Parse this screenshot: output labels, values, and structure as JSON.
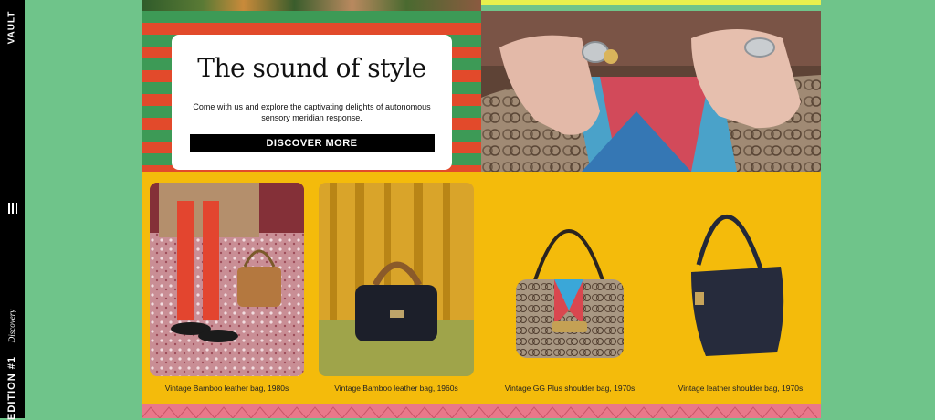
{
  "sidebar": {
    "brand": "VAULT",
    "discovery_label": "Discovery",
    "edition_label": "EDITION #1"
  },
  "promo": {
    "title": "The sound of style",
    "text": "Come with us and explore the captivating delights of autonomous sensory meridian response.",
    "button_label": "DISCOVER MORE"
  },
  "products": [
    {
      "caption": "Vintage Bamboo leather bag, 1980s"
    },
    {
      "caption": "Vintage Bamboo leather bag, 1960s"
    },
    {
      "caption": "Vintage GG Plus shoulder bag, 1970s"
    },
    {
      "caption": "Vintage leather shoulder bag, 1970s"
    }
  ],
  "colors": {
    "background": "#6fc48a",
    "stripe_green": "#3d9a56",
    "stripe_red": "#e24a2b",
    "yellow": "#f4bb0b",
    "pink": "#e9788a"
  }
}
